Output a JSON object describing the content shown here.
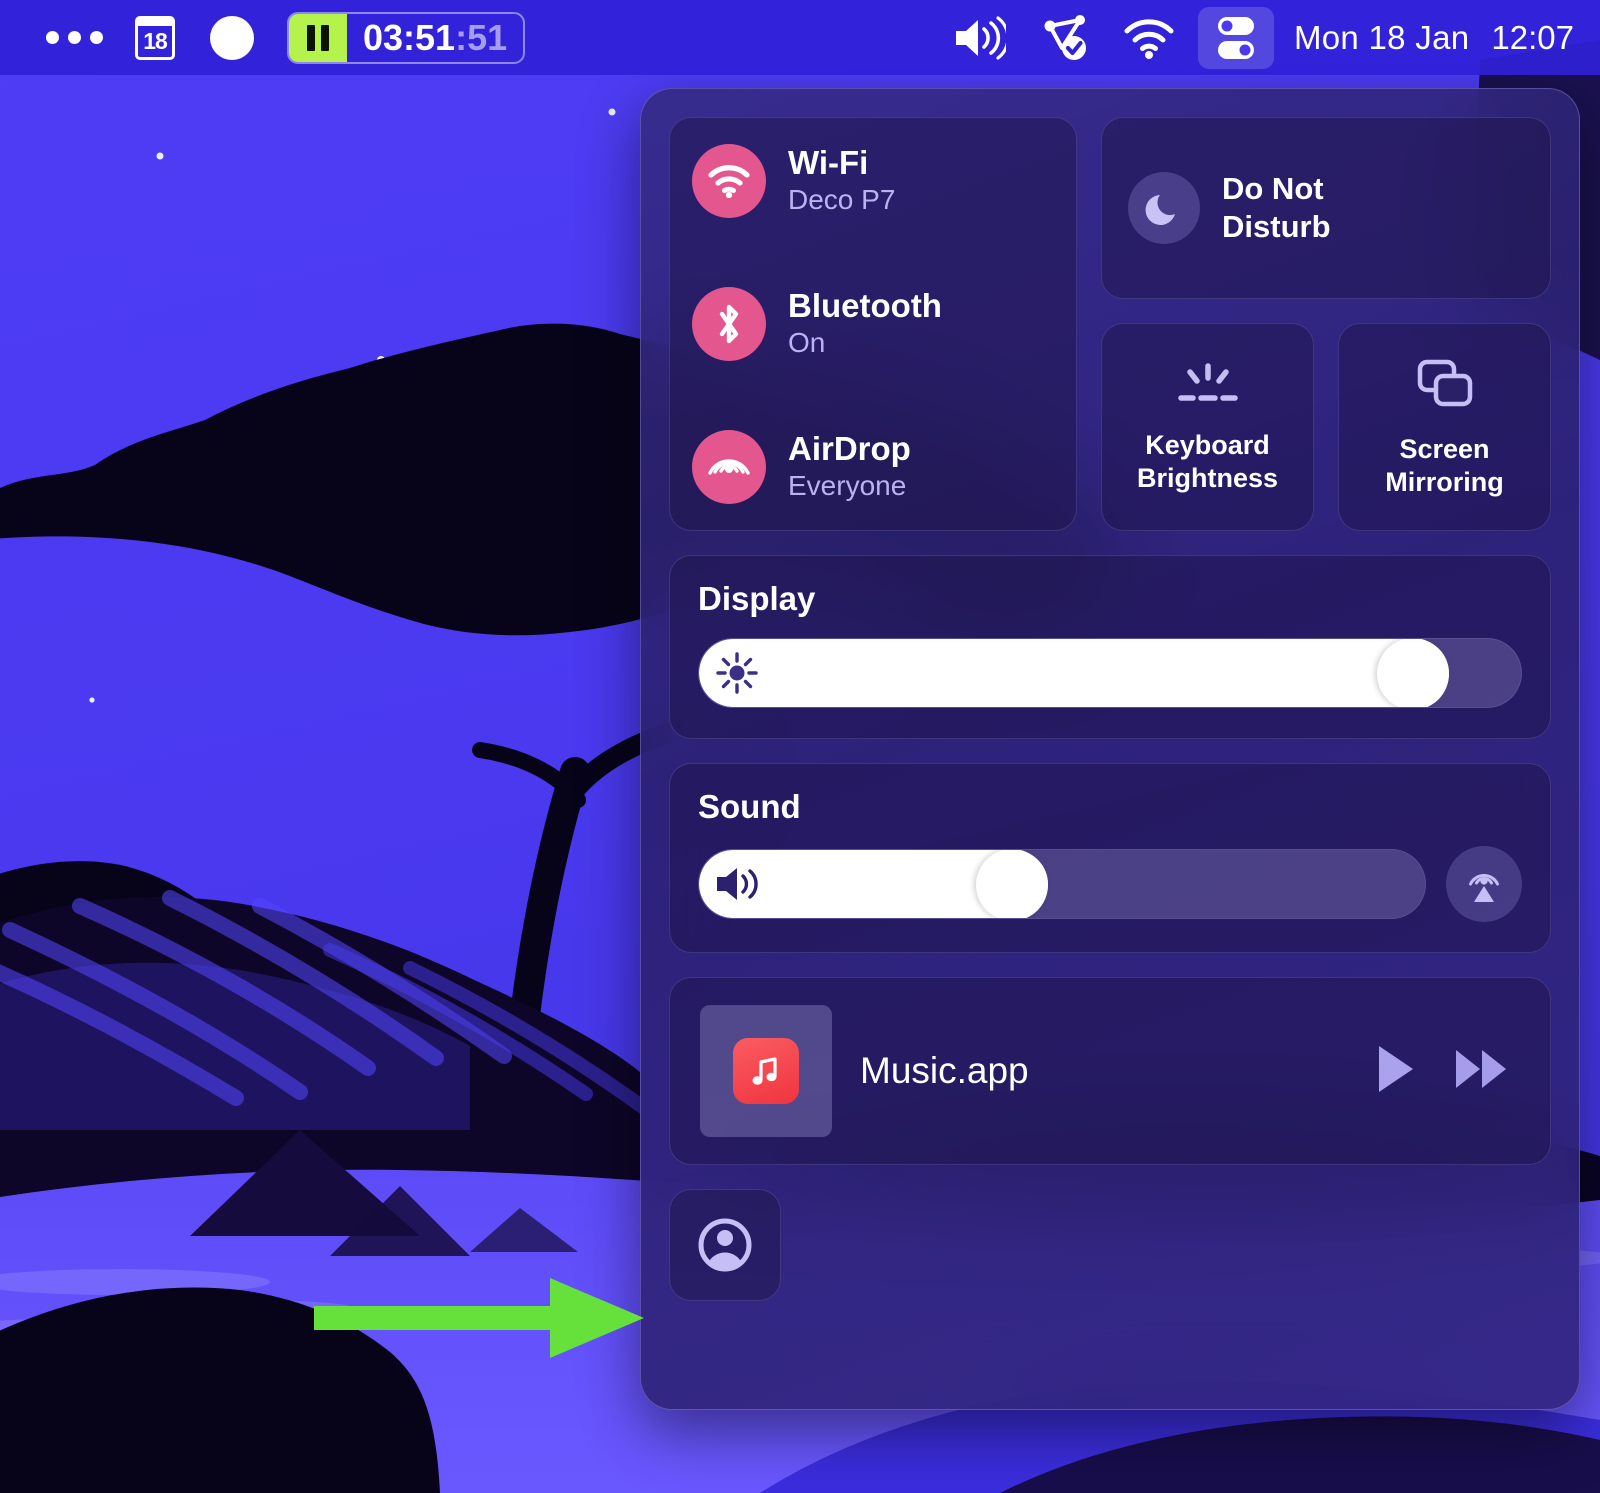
{
  "menubar": {
    "icons": [
      {
        "name": "ellipsis-icon",
        "glyph": "•••"
      },
      {
        "name": "calendar-icon",
        "glyph": "18"
      },
      {
        "name": "contrast-icon",
        "glyph": "◑"
      },
      {
        "name": "volume-icon",
        "glyph": "speaker"
      },
      {
        "name": "shortcuts-icon",
        "glyph": "shortcut-check"
      },
      {
        "name": "wifi-icon",
        "glyph": "wifi"
      },
      {
        "name": "control-center-icon",
        "glyph": "sliders"
      }
    ],
    "timer": {
      "state": "paused",
      "hours_minutes": "03:51",
      "seconds": ":51",
      "full": "03:51:51",
      "accent_color": "#b4f24c"
    },
    "calendar_day": "18",
    "date": "Mon 18 Jan",
    "time": "12:07"
  },
  "control_center": {
    "toggles": [
      {
        "id": "wifi",
        "icon": "wifi-icon",
        "title": "Wi-Fi",
        "subtitle": "Deco P7"
      },
      {
        "id": "bluetooth",
        "icon": "bluetooth-icon",
        "title": "Bluetooth",
        "subtitle": "On"
      },
      {
        "id": "airdrop",
        "icon": "airdrop-icon",
        "title": "AirDrop",
        "subtitle": "Everyone"
      }
    ],
    "toggle_accent_color": "#e4568e",
    "do_not_disturb": {
      "label": "Do Not Disturb",
      "label_line1": "Do Not",
      "label_line2": "Disturb",
      "icon": "moon-icon"
    },
    "small_tiles": [
      {
        "id": "keyboard-brightness",
        "icon": "keyboard-brightness-icon",
        "line1": "Keyboard",
        "line2": "Brightness"
      },
      {
        "id": "screen-mirroring",
        "icon": "screen-mirroring-icon",
        "line1": "Screen",
        "line2": "Mirroring"
      }
    ],
    "display": {
      "title": "Display",
      "icon": "brightness-icon",
      "value_percent": 91
    },
    "sound": {
      "title": "Sound",
      "icon": "speaker-icon",
      "value_percent": 48,
      "airplay_icon": "airplay-audio-icon"
    },
    "now_playing": {
      "app_name": "Music.app",
      "app_icon": "music-note-icon",
      "play_button": "play-icon",
      "forward_button": "fast-forward-icon"
    },
    "user_button": {
      "icon": "user-account-icon",
      "label": "Fast User Switching"
    }
  },
  "annotation": {
    "arrow": {
      "name": "green-arrow",
      "color": "#66e03a",
      "points_to": "user-account-button"
    }
  },
  "wallpaper": {
    "name": "big-sur-night-graphic",
    "sky_color": "#4b3bf0",
    "accent_dark": "#0b0620"
  }
}
